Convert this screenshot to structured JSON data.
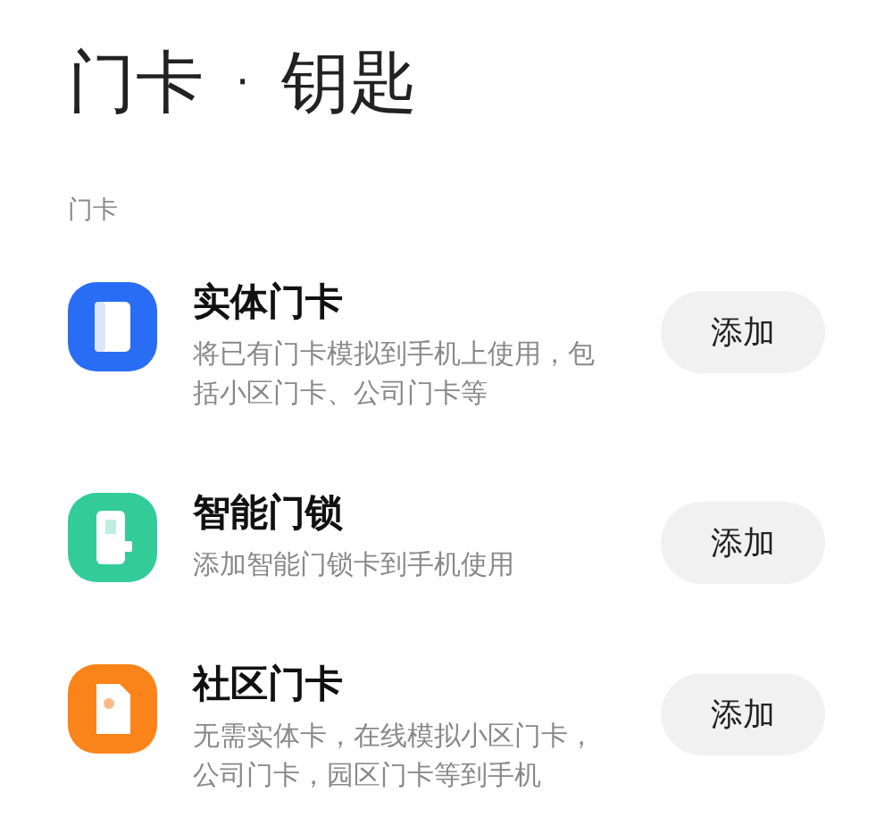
{
  "header": {
    "title": "门卡",
    "separator": "·",
    "subtitle": "钥匙"
  },
  "section": {
    "label": "门卡"
  },
  "items": [
    {
      "kind": "card",
      "color": "#2a6df5",
      "title": "实体门卡",
      "description": "将已有门卡模拟到手机上使用，包括小区门卡、公司门卡等",
      "button": "添加"
    },
    {
      "kind": "lock",
      "color": "#33cc99",
      "title": "智能门锁",
      "description": "添加智能门锁卡到手机使用",
      "button": "添加"
    },
    {
      "kind": "community",
      "color": "#fa8419",
      "title": "社区门卡",
      "description": "无需实体卡，在线模拟小区门卡，公司门卡，园区门卡等到手机",
      "button": "添加"
    }
  ]
}
